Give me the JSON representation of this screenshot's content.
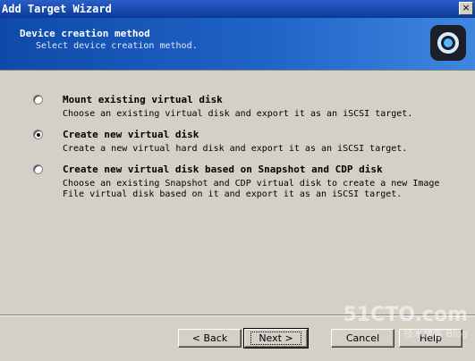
{
  "window": {
    "title": "Add Target Wizard",
    "close_label": "×"
  },
  "header": {
    "title": "Device creation method",
    "subtitle": "Select device creation method."
  },
  "options": [
    {
      "label": "Mount existing virtual disk",
      "description": [
        "Choose an existing virtual disk and export it as an iSCSI target."
      ],
      "selected": false
    },
    {
      "label": "Create new virtual disk",
      "description": [
        "Create a new virtual hard disk and export it as an iSCSI target."
      ],
      "selected": true
    },
    {
      "label": "Create new virtual disk based on Snapshot and CDP disk",
      "description": [
        "Choose an existing Snapshot and CDP virtual disk to create a new Image",
        "File virtual disk based on it and export it as an iSCSI target."
      ],
      "selected": false
    }
  ],
  "buttons": {
    "back": "< Back",
    "next": "Next >",
    "cancel": "Cancel",
    "help": "Help"
  },
  "watermark": {
    "brand": "51CTO.com",
    "sub": "技术博客 Blog"
  }
}
